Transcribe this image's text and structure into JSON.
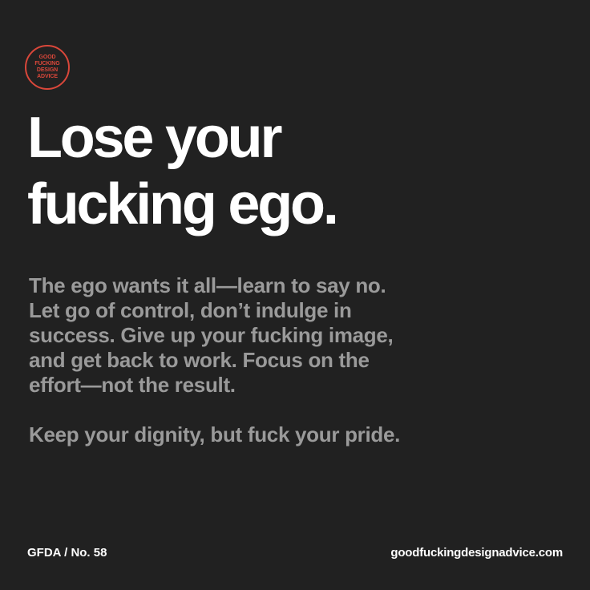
{
  "badge": {
    "lines": [
      "GOOD",
      "FUCKING",
      "DESIGN",
      "ADVICE"
    ]
  },
  "headline": {
    "lines": [
      "Lose your",
      "fucking ego."
    ]
  },
  "body": {
    "paragraph1": [
      "The ego wants it all—learn to say no.",
      "Let go of control, don’t indulge in",
      "success. Give up your fucking image,",
      "and get back to work. Focus on the",
      "effort—not the result."
    ],
    "paragraph2": "Keep your dignity, but fuck your pride."
  },
  "footer": {
    "issue": "GFDA / No. 58",
    "website": "goodfuckingdesignadvice.com"
  },
  "colors": {
    "background": "#212121",
    "headline": "#ffffff",
    "body": "#9a9a9a",
    "badge": "#d9473a"
  }
}
